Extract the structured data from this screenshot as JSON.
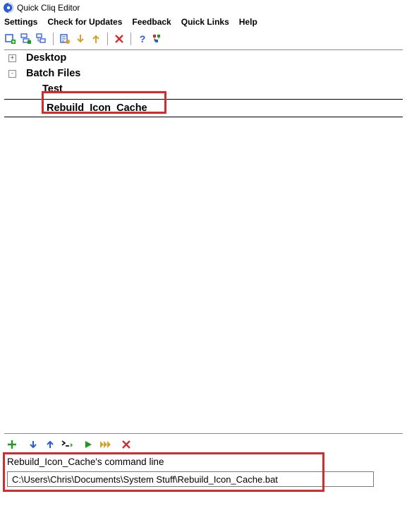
{
  "app": {
    "title": "Quick Cliq Editor"
  },
  "menu": {
    "settings": "Settings",
    "updates": "Check for Updates",
    "feedback": "Feedback",
    "quicklinks": "Quick Links",
    "help": "Help"
  },
  "toolbar": {
    "help_symbol": "?"
  },
  "tree": {
    "items": [
      {
        "label": "Desktop",
        "expand": "+"
      },
      {
        "label": "Batch Files",
        "expand": "-"
      },
      {
        "label": "Test"
      },
      {
        "label": "Rebuild_Icon_Cache"
      }
    ]
  },
  "command": {
    "label": "Rebuild_Icon_Cache's command line",
    "value": "C:\\Users\\Chris\\Documents\\System Stuff\\Rebuild_Icon_Cache.bat"
  }
}
